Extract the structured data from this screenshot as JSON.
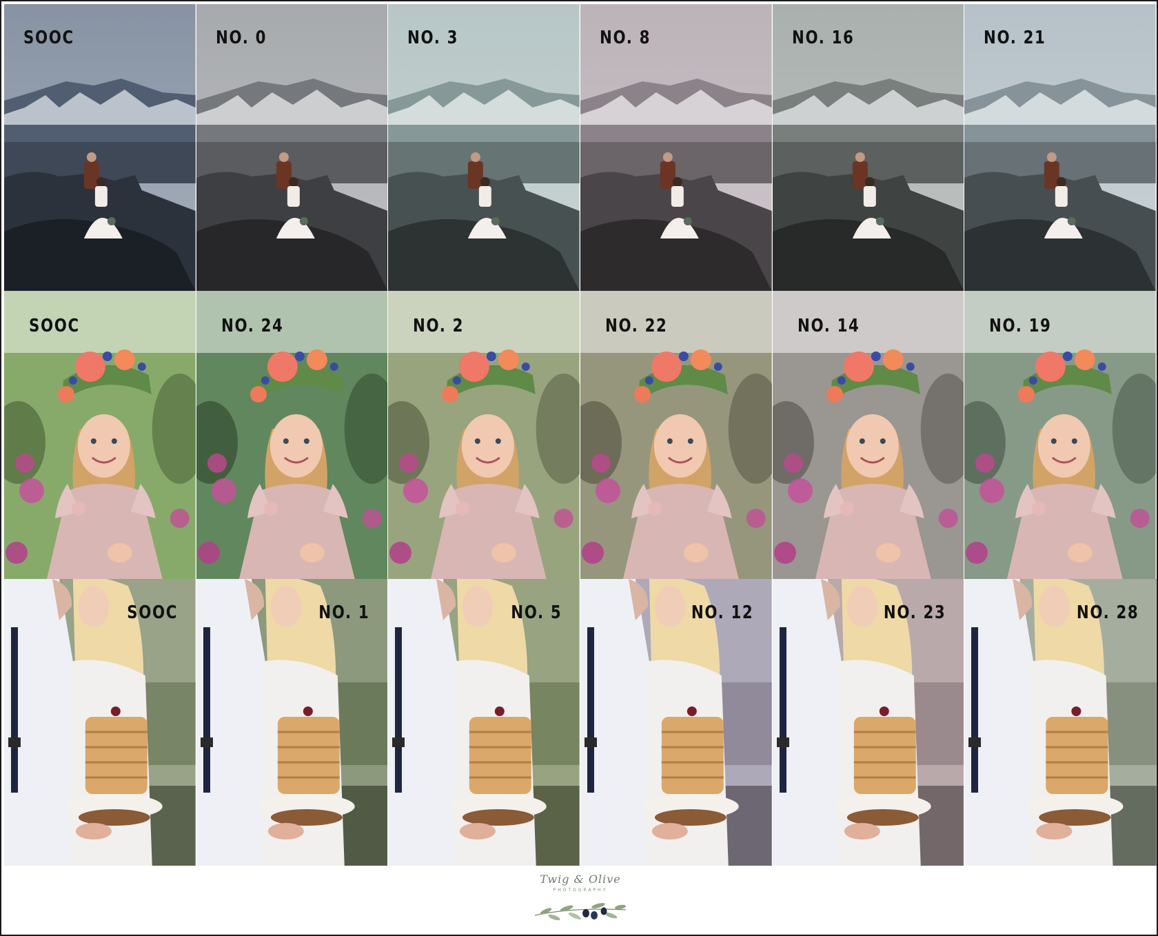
{
  "rows": [
    {
      "scene": "mountain-couple",
      "labels": [
        "SOOC",
        "NO. 0",
        "NO. 3",
        "NO. 8",
        "NO. 16",
        "NO. 21"
      ],
      "tones": [
        "#5f6f86",
        "#8a8d92",
        "#9fb3b3",
        "#a59aa2",
        "#8d9593",
        "#9eaeb5"
      ]
    },
    {
      "scene": "girl-flower-crown",
      "labels": [
        "SOOC",
        "NO. 24",
        "NO. 2",
        "NO. 22",
        "NO. 14",
        "NO. 19"
      ],
      "tones": [
        "#7aa05a",
        "#4f7a4c",
        "#8c9a6e",
        "#8a8a6e",
        "#8f8a86",
        "#7a8f7a"
      ]
    },
    {
      "scene": "couple-cake",
      "labels": [
        "SOOC",
        "NO. 1",
        "NO. 5",
        "NO. 12",
        "NO. 23",
        "NO. 28"
      ],
      "tones": [
        "#7e8c6a",
        "#6f7f5c",
        "#7d8c62",
        "#9a93a6",
        "#a89496",
        "#8f9a86"
      ]
    }
  ],
  "logo": {
    "script": "Twig & Olive",
    "sub": "PHOTOGRAPHY"
  }
}
